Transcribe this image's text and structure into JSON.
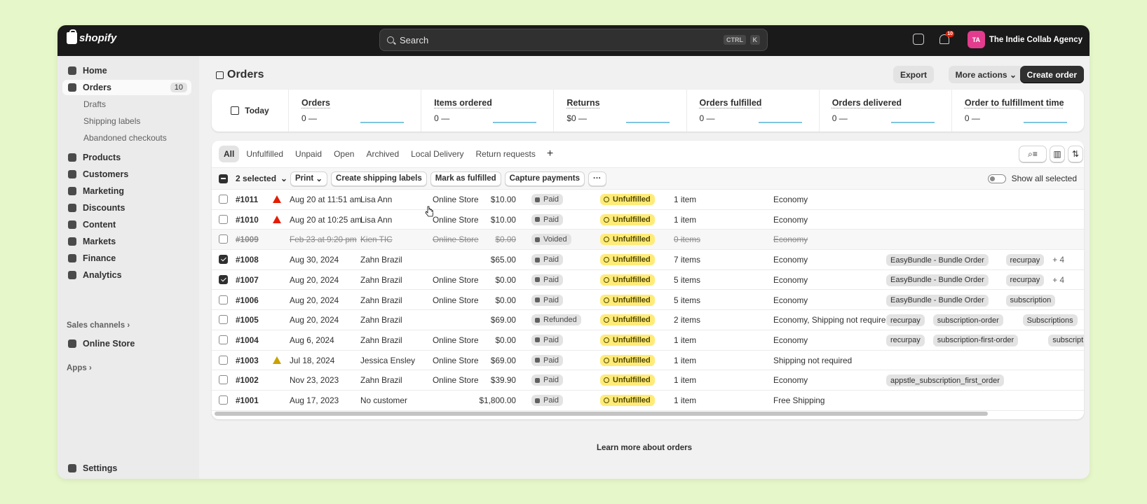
{
  "topbar": {
    "logo_text": "shopify",
    "search_placeholder": "Search",
    "shortcut_ctrl": "CTRL",
    "shortcut_k": "K",
    "notifications_count": "10",
    "avatar_initials": "TA",
    "store_name": "The Indie Collab Agency"
  },
  "sidebar": {
    "home": "Home",
    "orders": "Orders",
    "orders_count": "10",
    "drafts": "Drafts",
    "shipping_labels": "Shipping labels",
    "abandoned_checkouts": "Abandoned checkouts",
    "products": "Products",
    "customers": "Customers",
    "marketing": "Marketing",
    "discounts": "Discounts",
    "content": "Content",
    "markets": "Markets",
    "finance": "Finance",
    "analytics": "Analytics",
    "sales_channels": "Sales channels",
    "online_store": "Online Store",
    "apps": "Apps",
    "settings": "Settings"
  },
  "header": {
    "title": "Orders",
    "export": "Export",
    "more_actions": "More actions",
    "create_order": "Create order"
  },
  "stats": {
    "today": "Today",
    "items": [
      {
        "label": "Orders",
        "value": "0",
        "dash": "—"
      },
      {
        "label": "Items ordered",
        "value": "0",
        "dash": "—"
      },
      {
        "label": "Returns",
        "value": "$0",
        "dash": "—"
      },
      {
        "label": "Orders fulfilled",
        "value": "0",
        "dash": "—"
      },
      {
        "label": "Orders delivered",
        "value": "0",
        "dash": "—"
      },
      {
        "label": "Order to fulfillment time",
        "value": "0",
        "dash": "—"
      }
    ]
  },
  "tabs": [
    "All",
    "Unfulfilled",
    "Unpaid",
    "Open",
    "Archived",
    "Local Delivery",
    "Return requests"
  ],
  "tab_add": "+",
  "bulk": {
    "selected": "2 selected",
    "print": "Print",
    "create_shipping_labels": "Create shipping labels",
    "mark_as_fulfilled": "Mark as fulfilled",
    "capture_payments": "Capture payments",
    "more": "···",
    "show_all_selected": "Show all selected"
  },
  "orders": [
    {
      "number": "#1011",
      "date": "Aug 20 at 11:51 am",
      "customer": "Lisa Ann",
      "channel": "Online Store",
      "total": "$10.00",
      "payment": "Paid",
      "fulfillment": "Unfulfilled",
      "items": "1 item",
      "delivery": "Economy",
      "tags": [],
      "more": "",
      "checked": false,
      "warn": "red",
      "voided": false
    },
    {
      "number": "#1010",
      "date": "Aug 20 at 10:25 am",
      "customer": "Lisa Ann",
      "channel": "Online Store",
      "total": "$10.00",
      "payment": "Paid",
      "fulfillment": "Unfulfilled",
      "items": "1 item",
      "delivery": "Economy",
      "tags": [],
      "more": "",
      "checked": false,
      "warn": "red",
      "voided": false
    },
    {
      "number": "#1009",
      "date": "Feb 23 at 9:20 pm",
      "customer": "Kien TIC",
      "channel": "Online Store",
      "total": "$0.00",
      "payment": "Voided",
      "fulfillment": "Unfulfilled",
      "items": "0 items",
      "delivery": "Economy",
      "tags": [],
      "more": "",
      "checked": false,
      "warn": "",
      "voided": true
    },
    {
      "number": "#1008",
      "date": "Aug 30, 2024",
      "customer": "Zahn Brazil",
      "channel": "",
      "total": "$65.00",
      "payment": "Paid",
      "fulfillment": "Unfulfilled",
      "items": "7 items",
      "delivery": "Economy",
      "tags": [
        "EasyBundle - Bundle Order",
        "recurpay"
      ],
      "more": "+ 4",
      "checked": true,
      "warn": "",
      "voided": false
    },
    {
      "number": "#1007",
      "date": "Aug 20, 2024",
      "customer": "Zahn Brazil",
      "channel": "Online Store",
      "total": "$0.00",
      "payment": "Paid",
      "fulfillment": "Unfulfilled",
      "items": "5 items",
      "delivery": "Economy",
      "tags": [
        "EasyBundle - Bundle Order",
        "recurpay"
      ],
      "more": "+ 4",
      "checked": true,
      "warn": "",
      "voided": false
    },
    {
      "number": "#1006",
      "date": "Aug 20, 2024",
      "customer": "Zahn Brazil",
      "channel": "Online Store",
      "total": "$0.00",
      "payment": "Paid",
      "fulfillment": "Unfulfilled",
      "items": "5 items",
      "delivery": "Economy",
      "tags": [
        "EasyBundle - Bundle Order",
        "subscription"
      ],
      "more": "",
      "checked": false,
      "warn": "",
      "voided": false
    },
    {
      "number": "#1005",
      "date": "Aug 20, 2024",
      "customer": "Zahn Brazil",
      "channel": "",
      "total": "$69.00",
      "payment": "Refunded",
      "fulfillment": "Unfulfilled",
      "items": "2 items",
      "delivery": "Economy, Shipping not required",
      "tags": [
        "recurpay",
        "subscription-order",
        "Subscriptions"
      ],
      "more": "",
      "checked": false,
      "warn": "",
      "voided": false
    },
    {
      "number": "#1004",
      "date": "Aug 6, 2024",
      "customer": "Zahn Brazil",
      "channel": "Online Store",
      "total": "$0.00",
      "payment": "Paid",
      "fulfillment": "Unfulfilled",
      "items": "1 item",
      "delivery": "Economy",
      "tags": [
        "recurpay",
        "subscription-first-order",
        "subscription"
      ],
      "more": "",
      "checked": false,
      "warn": "",
      "voided": false
    },
    {
      "number": "#1003",
      "date": "Jul 18, 2024",
      "customer": "Jessica Ensley",
      "channel": "Online Store",
      "total": "$69.00",
      "payment": "Paid",
      "fulfillment": "Unfulfilled",
      "items": "1 item",
      "delivery": "Shipping not required",
      "tags": [],
      "more": "",
      "checked": false,
      "warn": "yellow",
      "voided": false
    },
    {
      "number": "#1002",
      "date": "Nov 23, 2023",
      "customer": "Zahn Brazil",
      "channel": "Online Store",
      "total": "$39.90",
      "payment": "Paid",
      "fulfillment": "Unfulfilled",
      "items": "1 item",
      "delivery": "Economy",
      "tags": [
        "appstle_subscription_first_order"
      ],
      "more": "",
      "checked": false,
      "warn": "",
      "voided": false
    },
    {
      "number": "#1001",
      "date": "Aug 17, 2023",
      "customer": "No customer",
      "channel": "",
      "total": "$1,800.00",
      "payment": "Paid",
      "fulfillment": "Unfulfilled",
      "items": "1 item",
      "delivery": "Free Shipping",
      "tags": [],
      "more": "",
      "checked": false,
      "warn": "",
      "voided": false
    }
  ],
  "footer": {
    "learn_more": "Learn more about orders"
  }
}
